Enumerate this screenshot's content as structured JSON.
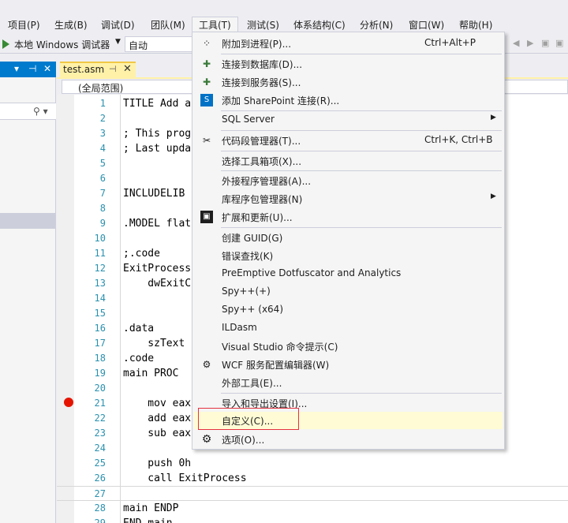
{
  "menubar": {
    "items": [
      "项目(P)",
      "生成(B)",
      "调试(D)",
      "团队(M)",
      "工具(T)",
      "测试(S)",
      "体系结构(C)",
      "分析(N)",
      "窗口(W)",
      "帮助(H)"
    ]
  },
  "toolbar": {
    "debugger_label": "本地 Windows 调试器",
    "config_value": "自动"
  },
  "editor": {
    "tab_title": "test.asm",
    "pin_glyph": "⊣",
    "close_glyph": "✕",
    "scope": "(全局范围)",
    "lines": [
      {
        "n": "1",
        "t": "TITLE Add a"
      },
      {
        "n": "2",
        "t": ""
      },
      {
        "n": "3",
        "t": "; This prog"
      },
      {
        "n": "4",
        "t": "; Last upda"
      },
      {
        "n": "5",
        "t": ""
      },
      {
        "n": "6",
        "t": ""
      },
      {
        "n": "7",
        "t": "INCLUDELIB "
      },
      {
        "n": "8",
        "t": ""
      },
      {
        "n": "9",
        "t": ".MODEL flat"
      },
      {
        "n": "10",
        "t": ""
      },
      {
        "n": "11",
        "t": ";.code"
      },
      {
        "n": "12",
        "t": "ExitProcess"
      },
      {
        "n": "13",
        "t": "    dwExitC"
      },
      {
        "n": "14",
        "t": ""
      },
      {
        "n": "15",
        "t": ""
      },
      {
        "n": "16",
        "t": ".data"
      },
      {
        "n": "17",
        "t": "    szText "
      },
      {
        "n": "18",
        "t": ".code"
      },
      {
        "n": "19",
        "t": "main PROC"
      },
      {
        "n": "20",
        "t": ""
      },
      {
        "n": "21",
        "t": "    mov eax"
      },
      {
        "n": "22",
        "t": "    add eax"
      },
      {
        "n": "23",
        "t": "    sub eax"
      },
      {
        "n": "24",
        "t": ""
      },
      {
        "n": "25",
        "t": "    push 0h"
      },
      {
        "n": "26",
        "t": "    call ExitProcess"
      },
      {
        "n": "27",
        "t": ""
      },
      {
        "n": "28",
        "t": "main ENDP"
      },
      {
        "n": "29",
        "t": "END main"
      }
    ]
  },
  "tools_menu": {
    "items": [
      {
        "label": "附加到进程(P)...",
        "shortcut": "Ctrl+Alt+P",
        "icon": "attach-process-icon"
      },
      {
        "label": "连接到数据库(D)...",
        "icon": "connect-database-icon"
      },
      {
        "label": "连接到服务器(S)...",
        "icon": "connect-server-icon"
      },
      {
        "label": "添加 SharePoint 连接(R)...",
        "icon": "sharepoint-icon"
      },
      {
        "label": "SQL Server",
        "submenu": true
      },
      {
        "label": "代码段管理器(T)...",
        "shortcut": "Ctrl+K, Ctrl+B",
        "icon": "code-snippets-icon"
      },
      {
        "label": "选择工具箱项(X)..."
      },
      {
        "label": "外接程序管理器(A)..."
      },
      {
        "label": "库程序包管理器(N)",
        "submenu": true
      },
      {
        "label": "扩展和更新(U)...",
        "icon": "extensions-icon"
      },
      {
        "label": "创建 GUID(G)"
      },
      {
        "label": "错误查找(K)"
      },
      {
        "label": "PreEmptive Dotfuscator and Analytics"
      },
      {
        "label": "Spy++(+)"
      },
      {
        "label": "Spy++ (x64)"
      },
      {
        "label": "ILDasm"
      },
      {
        "label": "Visual Studio 命令提示(C)"
      },
      {
        "label": "WCF 服务配置编辑器(W)",
        "icon": "wcf-config-icon"
      },
      {
        "label": "外部工具(E)..."
      },
      {
        "label": "导入和导出设置(I)..."
      },
      {
        "label": "自定义(C)...",
        "highlighted": true
      },
      {
        "label": "选项(O)...",
        "icon": "gear-icon"
      }
    ]
  },
  "colors": {
    "accent": "#007acc",
    "breakpoint": "#e51400",
    "highlight_border": "#e5323f",
    "tab": "#fff1a8"
  }
}
